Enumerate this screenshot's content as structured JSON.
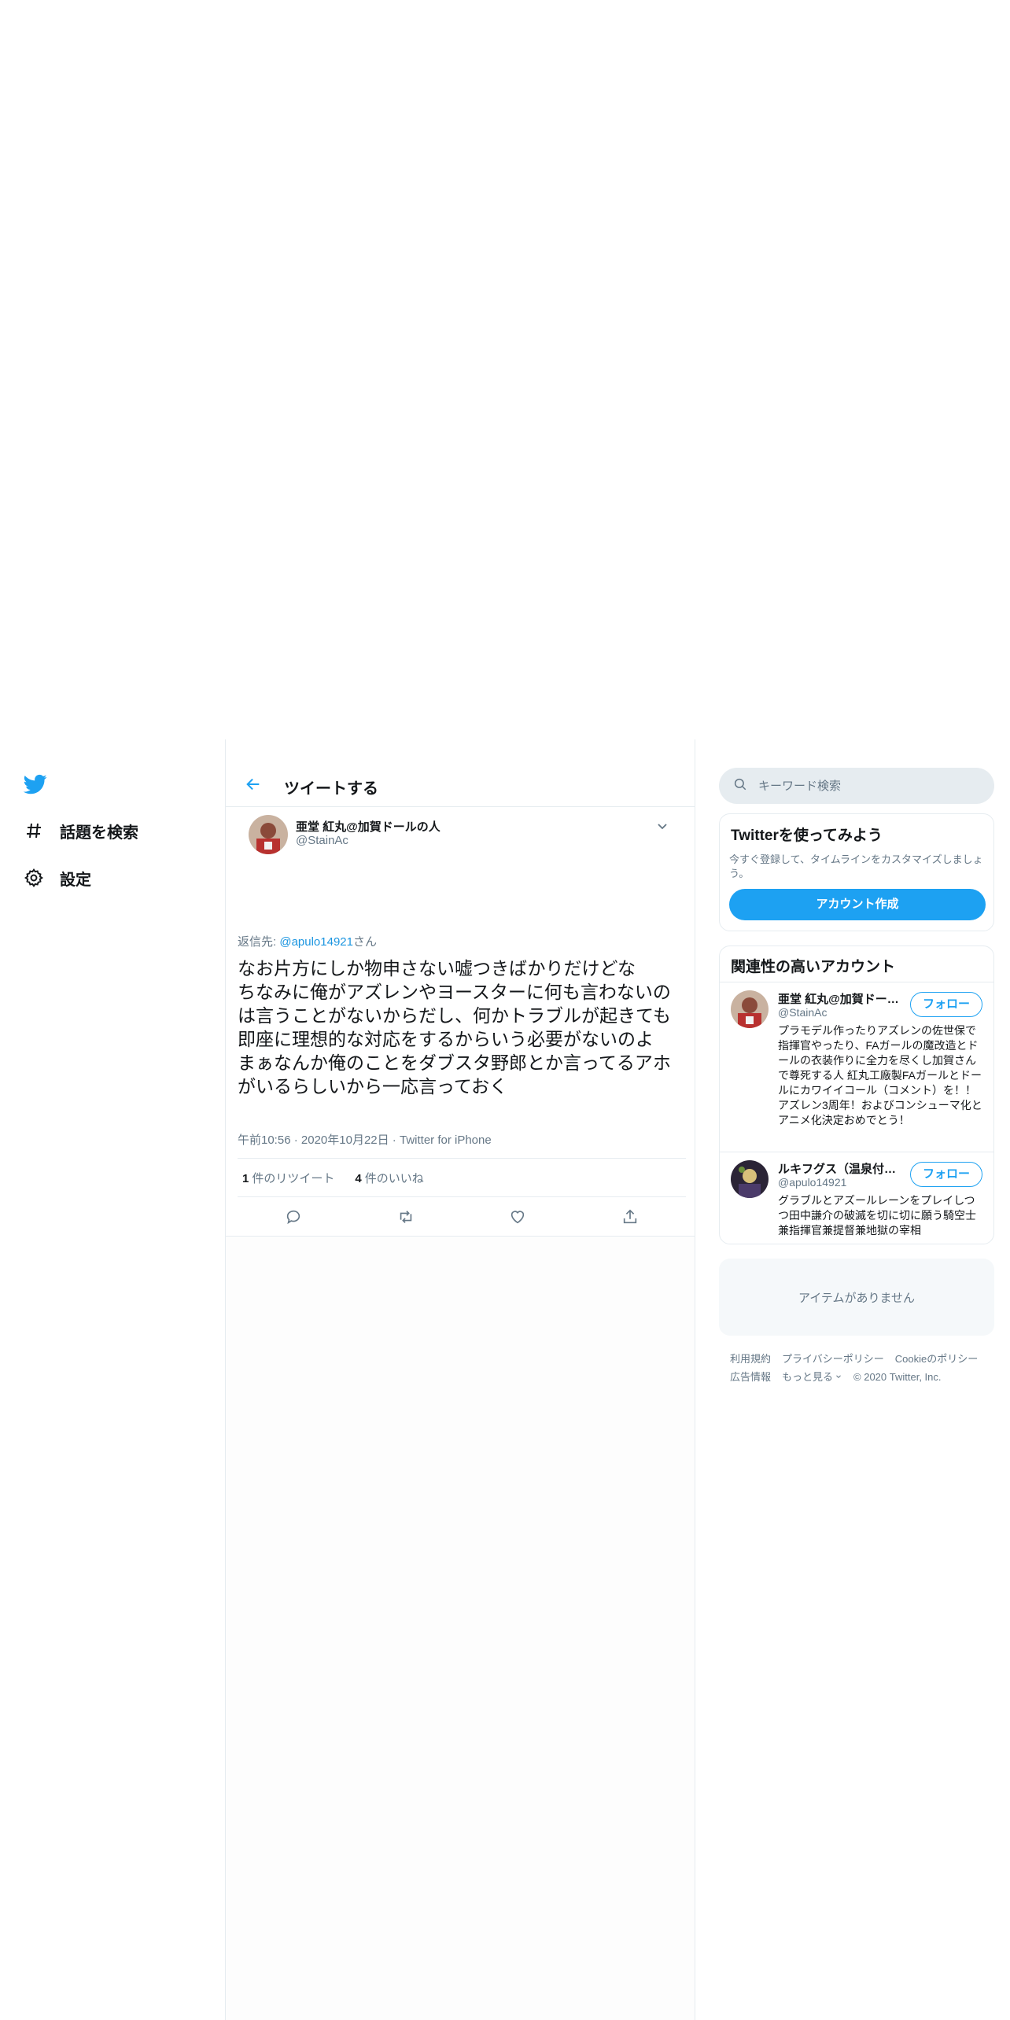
{
  "nav": {
    "items": [
      {
        "label": "話題を検索",
        "icon": "hashtag-icon"
      },
      {
        "label": "設定",
        "icon": "gear-icon"
      }
    ]
  },
  "header": {
    "title": "ツイートする"
  },
  "tweet": {
    "author_name": "亜堂 紅丸@加賀ドールの人",
    "author_handle": "@StainAc",
    "reply_prefix": "返信先: ",
    "reply_handle": "@apulo14921",
    "reply_suffix": "さん",
    "text": "なお片方にしか物申さない嘘つきばかりだけどな\nちなみに俺がアズレンやヨースターに何も言わないのは言うことがないからだし、何かトラブルが起きても即座に理想的な対応をするからいう必要がないのよ\nまぁなんか俺のことをダブスタ野郎とか言ってるアホがいるらしいから一応言っておく",
    "time": "午前10:56",
    "date": "2020年10月22日",
    "source": "Twitter for iPhone",
    "retweet_count": "1",
    "retweet_label": "件のリツイート",
    "like_count": "4",
    "like_label": "件のいいね"
  },
  "search": {
    "placeholder": "キーワード検索"
  },
  "signup": {
    "title": "Twitterを使ってみよう",
    "description": "今すぐ登録して、タイムラインをカスタマイズしましょう。",
    "button": "アカウント作成"
  },
  "related": {
    "title": "関連性の高いアカウント",
    "accounts": [
      {
        "name": "亜堂 紅丸@加賀ドールの人",
        "handle": "@StainAc",
        "follow": "フォロー",
        "bio": "プラモデル作ったりアズレンの佐世保で指揮官やったり、FAガールの魔改造とドールの衣装作りに全力を尽くし加賀さんで尊死する人 紅丸工廠製FAガールとドールにカワイイコール（コメント）を！！ アズレン3周年！およびコンシューマ化とアニメ化決定おめでとう！"
      },
      {
        "name": "ルキフグス（温泉付き）",
        "handle": "@apulo14921",
        "follow": "フォロー",
        "bio": "グラブルとアズールレーンをプレイしつつ田中謙介の破滅を切に切に願う騎空士兼指揮官兼提督兼地獄の宰相"
      }
    ]
  },
  "empty_text": "アイテムがありません",
  "footer": {
    "links": [
      "利用規約",
      "プライバシーポリシー",
      "Cookieのポリシー",
      "広告情報",
      "もっと見る"
    ],
    "copyright": "© 2020 Twitter, Inc."
  },
  "colors": {
    "accent": "#1da1f2",
    "link": "#1b95e0",
    "muted": "#657786"
  }
}
